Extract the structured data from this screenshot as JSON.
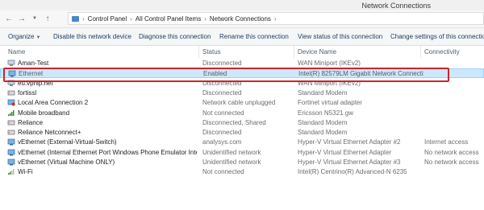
{
  "window": {
    "title": "Network Connections"
  },
  "breadcrumbs": [
    "Control Panel",
    "All Control Panel Items",
    "Network Connections"
  ],
  "toolbar": {
    "organize": "Organize",
    "disable": "Disable this network device",
    "diagnose": "Diagnose this connection",
    "rename": "Rename this connection",
    "view_status": "View status of this connection",
    "change_settings": "Change settings of this connection"
  },
  "columns": {
    "name": "Name",
    "status": "Status",
    "device": "Device Name",
    "connectivity": "Connectivity"
  },
  "rows": [
    {
      "name": "Aman-Test",
      "status": "Disconnected",
      "device": "WAN Miniport (IKEv2)",
      "connectivity": "",
      "icon": "vpn-icon"
    },
    {
      "name": "Ethernet",
      "status": "Enabled",
      "device": "Intel(R) 82579LM Gigabit Network Connection",
      "connectivity": "",
      "icon": "ethernet-icon",
      "selected": true
    },
    {
      "name": "eu.vpnip.net",
      "status": "Disconnected",
      "device": "WAN Miniport (IKEv2)",
      "connectivity": "",
      "icon": "vpn-icon"
    },
    {
      "name": "fortissl",
      "status": "Disconnected",
      "device": "Standard Modem",
      "connectivity": "",
      "icon": "modem-icon"
    },
    {
      "name": "Local Area Connection 2",
      "status": "Network cable unplugged",
      "device": "Fortinet virtual adapter",
      "connectivity": "",
      "icon": "ethernet-disconnected-icon"
    },
    {
      "name": "Mobile broadband",
      "status": "Not connected",
      "device": "Ericsson N5321 gw",
      "connectivity": "",
      "icon": "signal-bars-icon"
    },
    {
      "name": "Reliance",
      "status": "Disconnected, Shared",
      "device": "Standard Modem",
      "connectivity": "",
      "icon": "modem-icon"
    },
    {
      "name": "Reliance Netconnect+",
      "status": "Disconnected",
      "device": "Standard Modem",
      "connectivity": "",
      "icon": "modem-icon"
    },
    {
      "name": "vEthernet (External-Virtual-Switch)",
      "status": "analysys.com",
      "device": "Hyper-V Virtual Ethernet Adapter #2",
      "connectivity": "Internet access",
      "icon": "ethernet-icon"
    },
    {
      "name": "vEthernet (Internal Ethernet Port Windows Phone Emulator Interna...",
      "status": "Unidentified network",
      "device": "Hyper-V Virtual Ethernet Adapter",
      "connectivity": "No network access",
      "icon": "ethernet-icon"
    },
    {
      "name": "vEthernet (Virtual Machine ONLY)",
      "status": "Unidentified network",
      "device": "Hyper-V Virtual Ethernet Adapter #3",
      "connectivity": "No network access",
      "icon": "ethernet-icon"
    },
    {
      "name": "Wi-Fi",
      "status": "Not connected",
      "device": "Intel(R) Centrino(R) Advanced-N 6235",
      "connectivity": "",
      "icon": "wifi-signal-icon"
    }
  ],
  "colors": {
    "selection_bg": "#cce8ff",
    "selection_border": "#99d1ff",
    "highlight_box": "#c9252c",
    "toolbar_text": "#1e3a5c"
  }
}
